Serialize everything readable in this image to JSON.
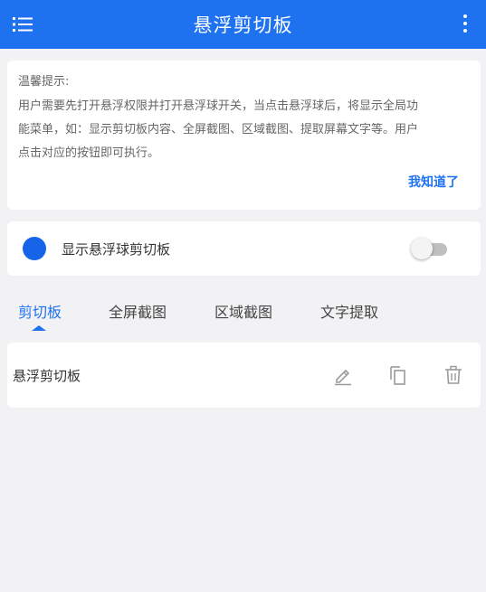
{
  "appbar": {
    "title": "悬浮剪切板",
    "menu_icon": "list-menu-icon",
    "more_icon": "more-vertical-icon",
    "color": "#1e72f0"
  },
  "tip": {
    "title": "温馨提示:",
    "line1": "用户需要先打开悬浮权限并打开悬浮球开关，当点击悬浮球后，将显示全局功",
    "line2": "能菜单，如：显示剪切板内容、全屏截图、区域截图、提取屏幕文字等。用户",
    "line3": "点击对应的按钮即可执行。",
    "ok_label": "我知道了"
  },
  "toggle": {
    "label": "显示悬浮球剪切板",
    "enabled": false
  },
  "tabs": [
    {
      "label": "剪切板",
      "active": true
    },
    {
      "label": "全屏截图",
      "active": false
    },
    {
      "label": "区域截图",
      "active": false
    },
    {
      "label": "文字提取",
      "active": false
    }
  ],
  "clips": [
    {
      "text": "悬浮剪切板",
      "edit_icon": "pencil-icon",
      "copy_icon": "copy-icon",
      "delete_icon": "trash-icon"
    }
  ]
}
